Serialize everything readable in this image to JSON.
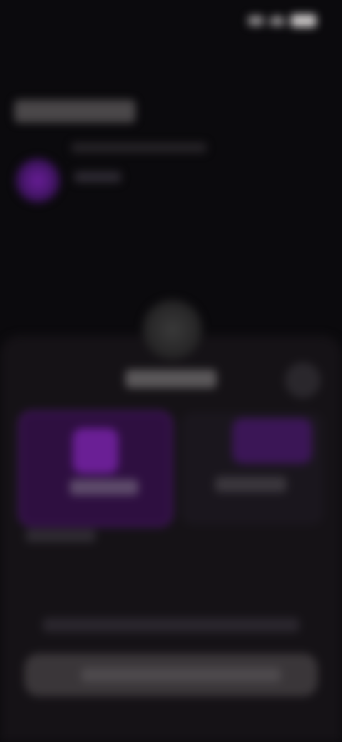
{
  "status_bar": {
    "time": "",
    "icons": [
      "signal-icon",
      "wifi-icon",
      "battery-icon"
    ]
  },
  "header": {
    "title": "",
    "subtitle": "",
    "avatar_label": ""
  },
  "sheet": {
    "title": "",
    "options": [
      {
        "label": "",
        "selected": true
      },
      {
        "label": "",
        "selected": false
      }
    ],
    "helper_text": "",
    "footnote": "",
    "cta_label": ""
  },
  "colors": {
    "background": "#0b0a0d",
    "sheet": "#151216",
    "accent_purple": "#6a1f95",
    "selected_option": "#2e0f40"
  }
}
